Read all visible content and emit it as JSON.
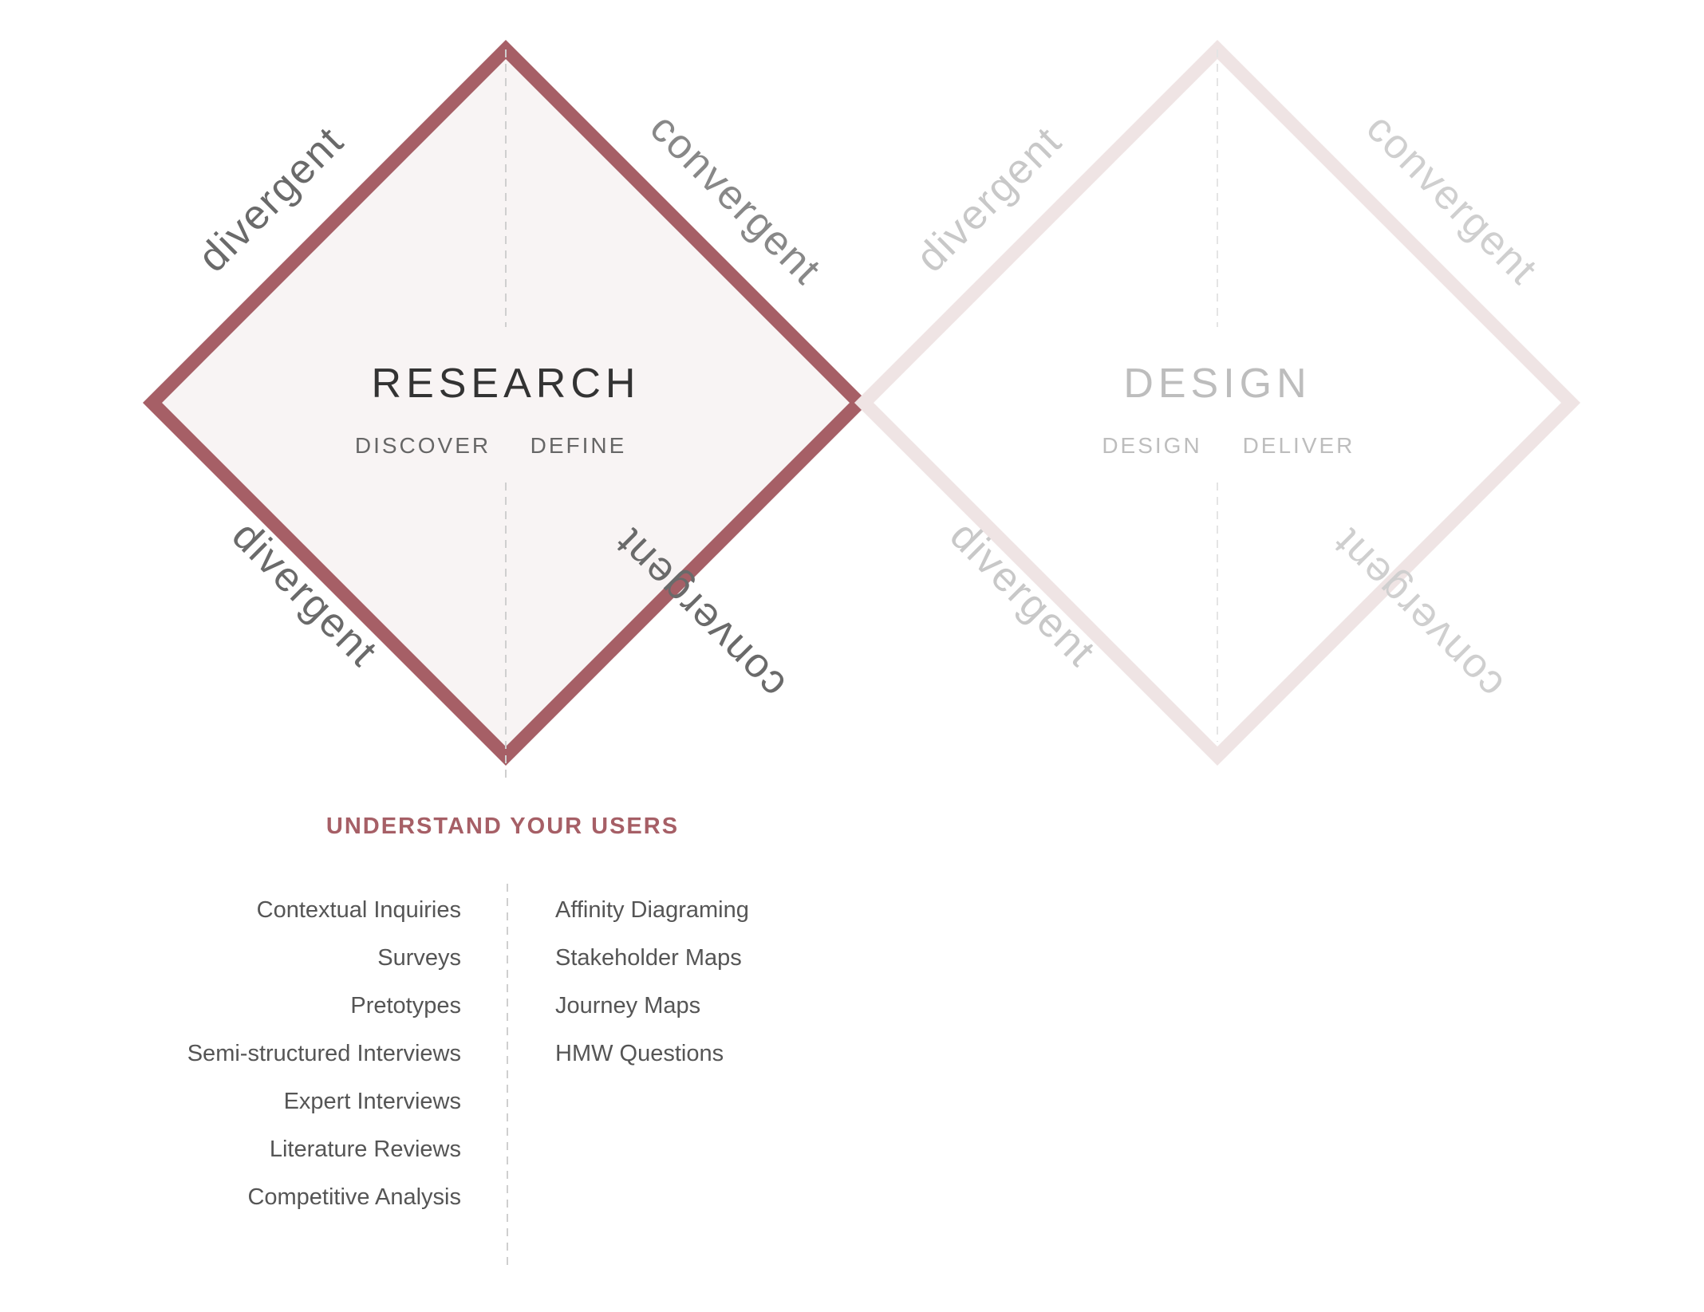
{
  "colors": {
    "accent": "#a65f66",
    "accent_fill": "#f8f4f4",
    "faded_stroke": "#efe4e4",
    "active_text": "#333333",
    "active_sub": "#666666",
    "edge_active": "#6a6a6a",
    "faded_text": "#bdbdbd",
    "item_text": "#555555",
    "dash": "#cfcfcf"
  },
  "diamonds": [
    {
      "id": "research",
      "active": true,
      "title": "RESEARCH",
      "left_phase": "DISCOVER",
      "right_phase": "DEFINE",
      "edges": {
        "top_left": "divergent",
        "top_right": "convergent",
        "bottom_left": "divergent",
        "bottom_right": "convergent"
      }
    },
    {
      "id": "design",
      "active": false,
      "title": "DESIGN",
      "left_phase": "DESIGN",
      "right_phase": "DELIVER",
      "edges": {
        "top_left": "divergent",
        "top_right": "convergent",
        "bottom_left": "divergent",
        "bottom_right": "convergent"
      }
    }
  ],
  "section": {
    "heading": "UNDERSTAND YOUR USERS",
    "discover_methods": [
      "Contextual Inquiries",
      "Surveys",
      "Pretotypes",
      "Semi-structured Interviews",
      "Expert Interviews",
      "Literature Reviews",
      "Competitive Analysis"
    ],
    "define_methods": [
      "Affinity Diagraming",
      "Stakeholder Maps",
      "Journey Maps",
      "HMW Questions"
    ]
  }
}
